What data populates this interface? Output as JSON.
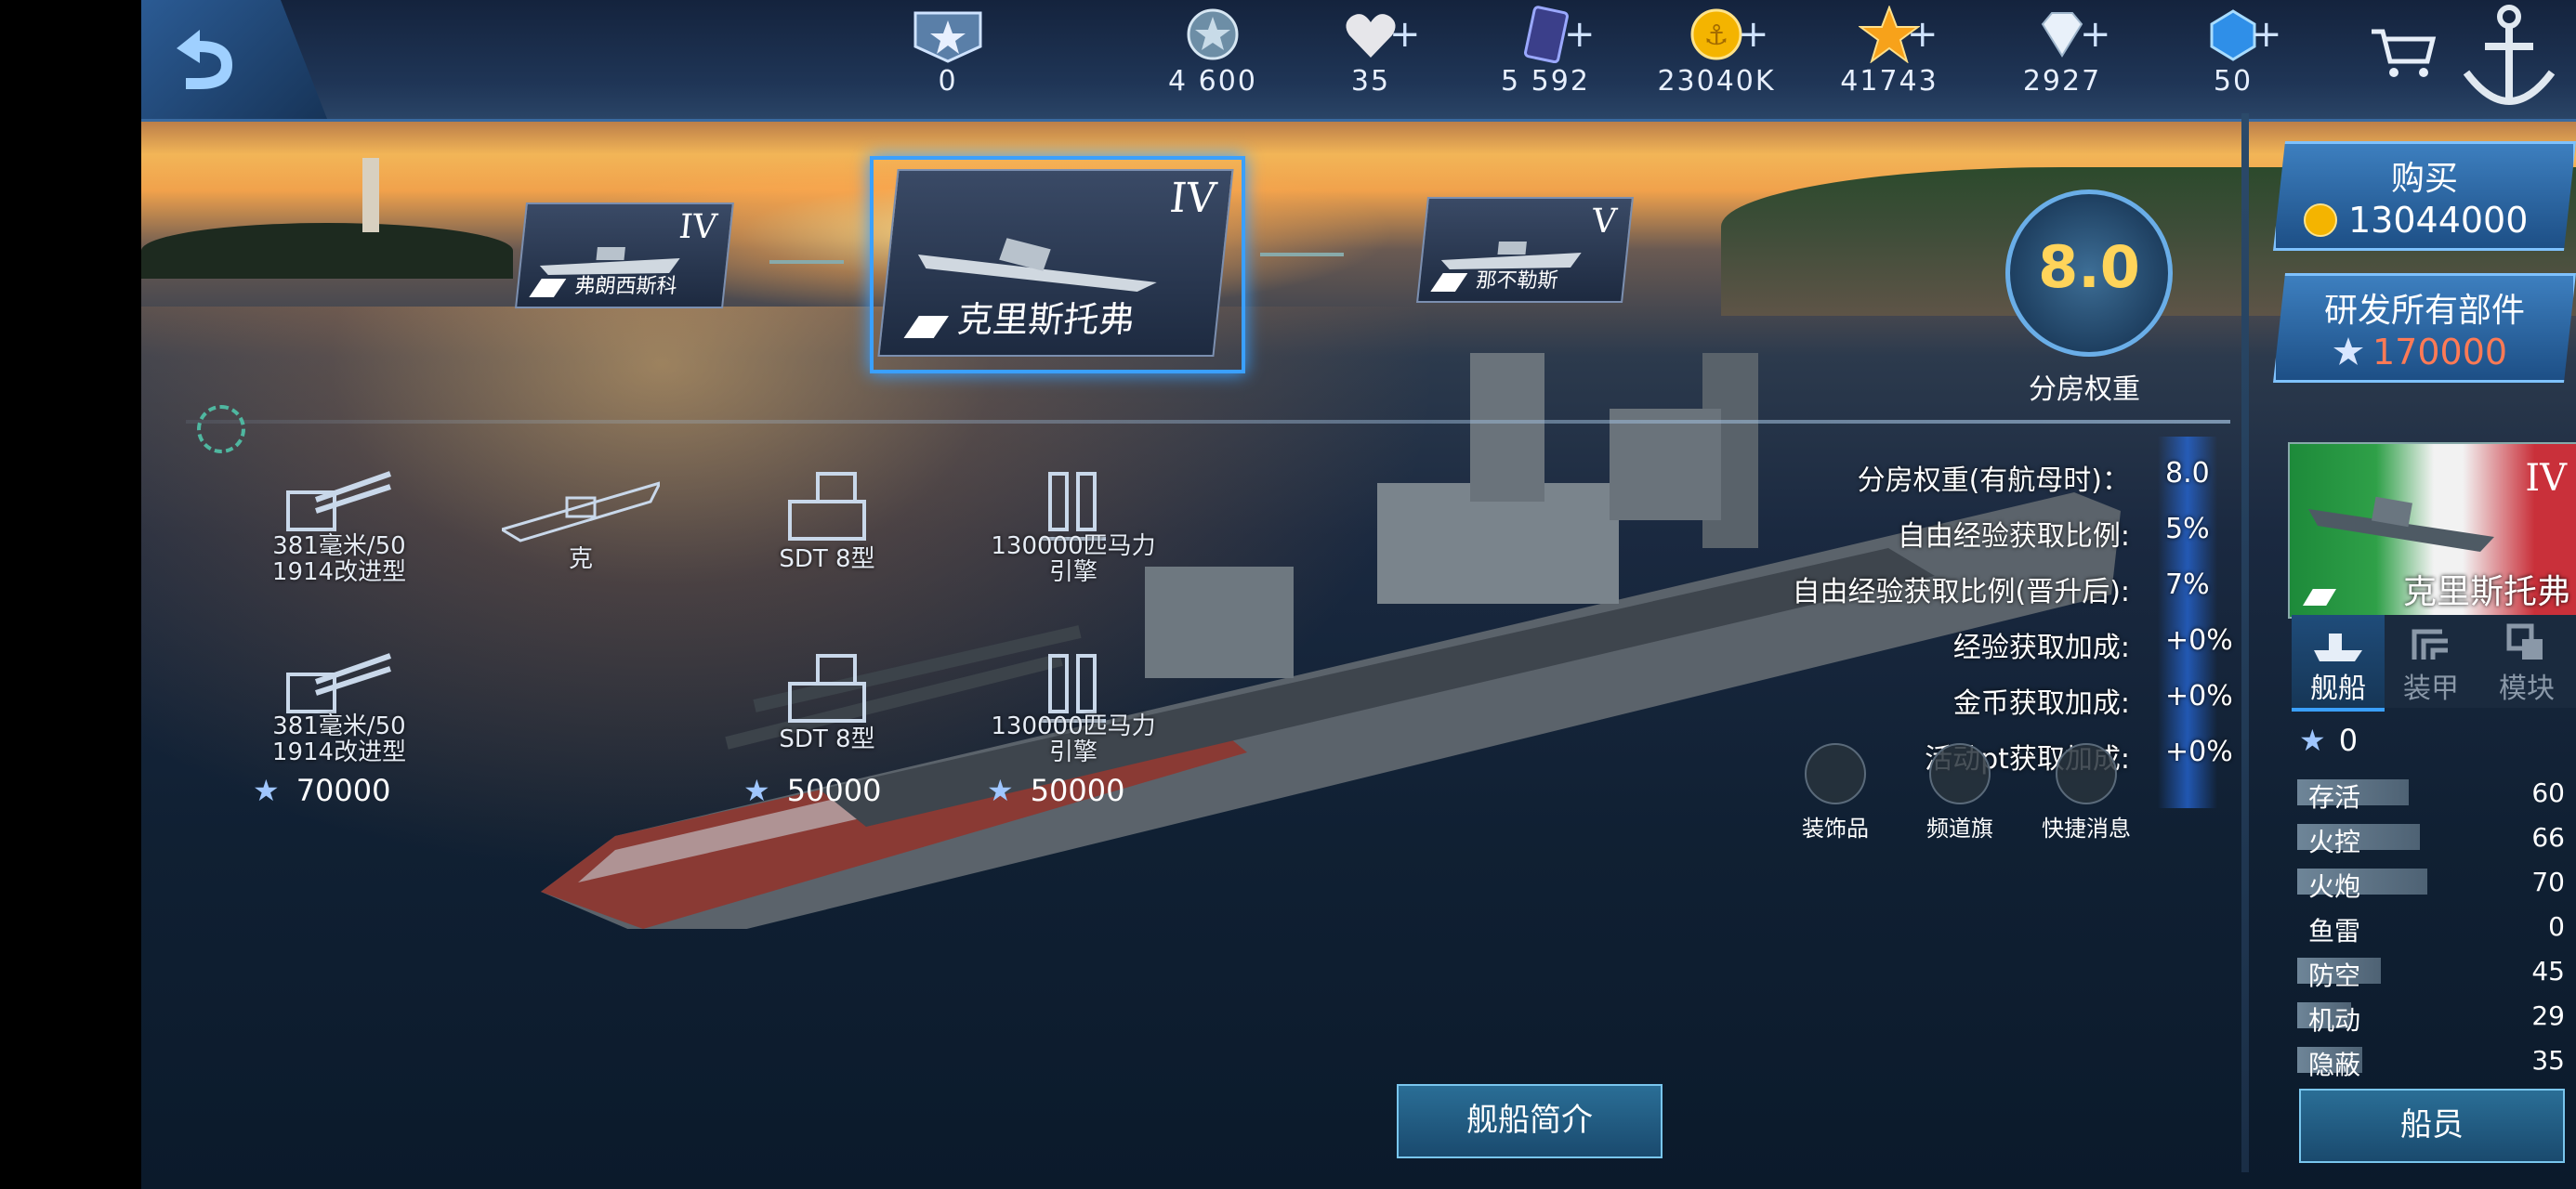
{
  "resources": [
    {
      "name": "medal-icon",
      "value": "0",
      "plus": false
    },
    {
      "name": "silver-icon",
      "value": "4 600",
      "plus": false
    },
    {
      "name": "heart-icon",
      "value": "35",
      "plus": true
    },
    {
      "name": "card-icon",
      "value": "5 592",
      "plus": true
    },
    {
      "name": "gold-coin-icon",
      "value": "23040K",
      "plus": true
    },
    {
      "name": "star-icon",
      "value": "41743",
      "plus": true
    },
    {
      "name": "diamond-icon",
      "value": "2927",
      "plus": true
    },
    {
      "name": "gem-icon",
      "value": "50",
      "plus": true
    }
  ],
  "ships": {
    "prev": {
      "tier": "IV",
      "name": "弗朗西斯科"
    },
    "current": {
      "tier": "IV",
      "name": "克里斯托弗"
    },
    "next": {
      "tier": "V",
      "name": "那不勒斯"
    }
  },
  "rating": {
    "value": "8.0",
    "label": "分房权重"
  },
  "buy": {
    "label": "购买",
    "price": "13044000"
  },
  "research": {
    "label": "研发所有部件",
    "price": "170000"
  },
  "info": [
    {
      "label": "分房权重(有航母时)：",
      "value": "8.0"
    },
    {
      "label": "自由经验获取比例:",
      "value": "5%"
    },
    {
      "label": "自由经验获取比例(晋升后):",
      "value": "7%"
    },
    {
      "label": "经验获取加成:",
      "value": "+0%"
    },
    {
      "label": "金币获取加成:",
      "value": "+0%"
    },
    {
      "label": "活动pt获取加成:",
      "value": "+0%"
    }
  ],
  "modules_row1": [
    {
      "label": "381毫米/50\n1914改进型"
    },
    {
      "label": "克"
    },
    {
      "label": "SDT 8型"
    },
    {
      "label": "130000匹马力\n引擎"
    }
  ],
  "modules_row2": [
    {
      "label": "381毫米/50\n1914改进型",
      "cost": "70000"
    },
    {
      "label": "SDT 8型",
      "cost": "50000"
    },
    {
      "label": "130000匹马力\n引擎",
      "cost": "50000"
    }
  ],
  "emotes": [
    {
      "label": "装饰品"
    },
    {
      "label": "频道旗"
    },
    {
      "label": "快捷消息"
    }
  ],
  "profile_btn": "舰船简介",
  "side": {
    "tier": "IV",
    "name": "克里斯托弗",
    "tabs": [
      {
        "label": "舰船"
      },
      {
        "label": "装甲"
      },
      {
        "label": "模块"
      }
    ],
    "points": "0",
    "stats": [
      {
        "label": "存活",
        "value": "60",
        "fill": 0.6
      },
      {
        "label": "火控",
        "value": "66",
        "fill": 0.66
      },
      {
        "label": "火炮",
        "value": "70",
        "fill": 0.7
      },
      {
        "label": "鱼雷",
        "value": "0",
        "fill": 0
      },
      {
        "label": "防空",
        "value": "45",
        "fill": 0.45
      },
      {
        "label": "机动",
        "value": "29",
        "fill": 0.29
      },
      {
        "label": "隐蔽",
        "value": "35",
        "fill": 0.35
      }
    ],
    "crew": "船员"
  },
  "colors": {
    "accent": "#3aa0ff",
    "gold": "#f4b400",
    "price_red": "#ff7a55"
  }
}
